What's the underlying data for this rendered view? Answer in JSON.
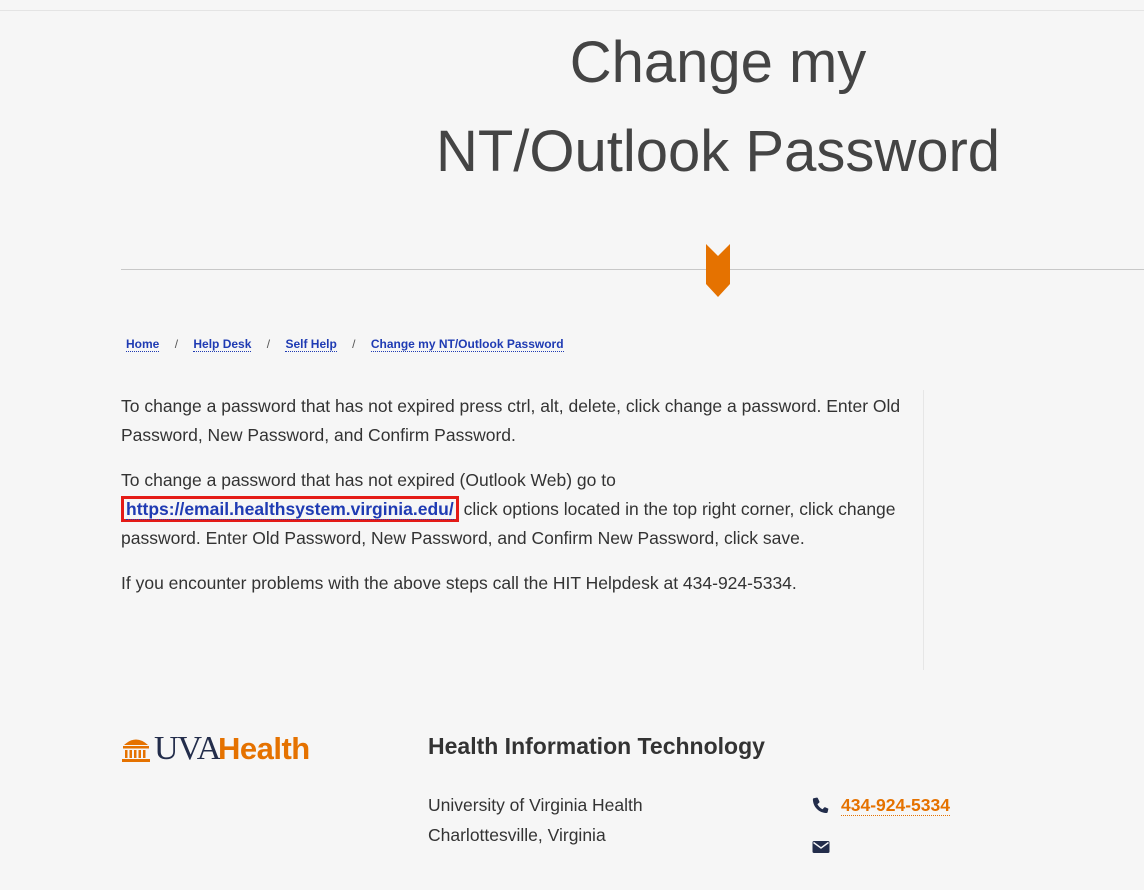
{
  "page": {
    "title_line1": "Change my",
    "title_line2": "NT/Outlook Password"
  },
  "breadcrumb": {
    "items": [
      "Home",
      "Help Desk",
      "Self Help",
      "Change my NT/Outlook Password"
    ],
    "separator": "/"
  },
  "content": {
    "para1": "To change a password that has not expired press ctrl, alt, delete, click change a password. Enter Old Password, New Password, and Confirm Password.",
    "para2_before": "To change a password that has not expired (Outlook Web) go to",
    "para2_link": "https://email.healthsystem.virginia.edu/",
    "para2_after": "click options located in the top right corner, click change password.  Enter Old Password, New Password, and Confirm New Password, click save.",
    "para3": "If you encounter problems with the above steps call the HIT Helpdesk at 434-924-5334."
  },
  "footer": {
    "logo_uva": "UVA",
    "logo_health": "Health",
    "heading": "Health Information Technology",
    "address_line1": "University of Virginia Health",
    "address_line2": "Charlottesville, Virginia",
    "phone": "434-924-5334"
  },
  "colors": {
    "accent": "#e57200",
    "link": "#1f3bb3",
    "highlight_box": "#e41b17",
    "navy": "#232d4b"
  },
  "icons": {
    "chevron": "chevron-down-icon",
    "phone": "phone-icon",
    "email": "envelope-icon",
    "logo": "rotunda-icon"
  }
}
